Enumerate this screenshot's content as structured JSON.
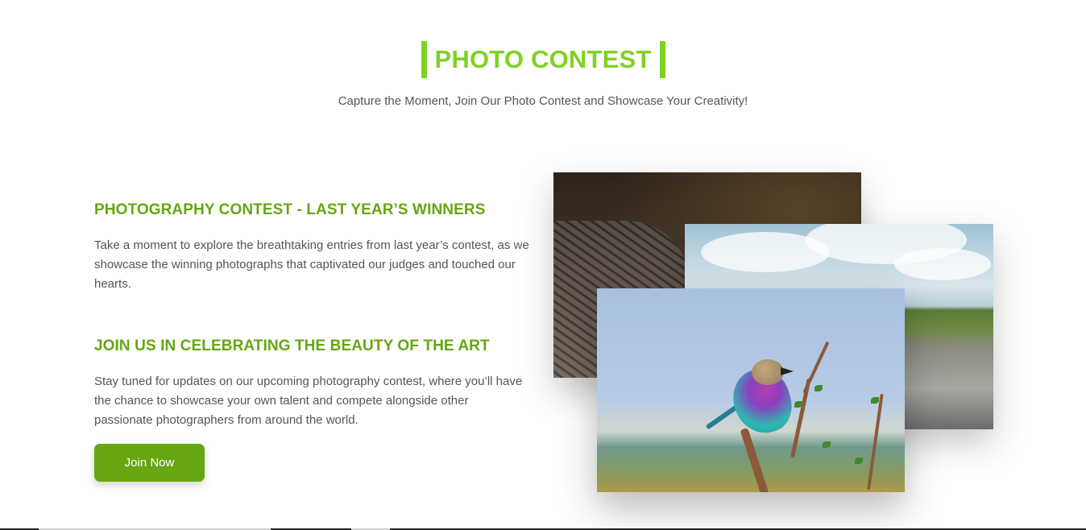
{
  "header": {
    "title": "PHOTO CONTEST",
    "subtitle": "Capture the Moment, Join Our Photo Contest and Showcase Your Creativity!"
  },
  "sections": [
    {
      "heading": "PHOTOGRAPHY CONTEST - LAST YEAR’S WINNERS",
      "text": "Take a moment to explore the breathtaking entries from last year’s contest, as we showcase the winning photographs that captivated our judges and touched our hearts."
    },
    {
      "heading": "JOIN US IN CELEBRATING THE BEAUTY OF THE ART",
      "text": "Stay tuned for updates on our upcoming photography contest, where you’ll have the chance to showcase your own talent and compete alongside other passionate photographers from around the world."
    }
  ],
  "cta": {
    "label": "Join Now"
  },
  "photos": [
    {
      "subject": "iguana-closeup"
    },
    {
      "subject": "coastal-cliff-landscape"
    },
    {
      "subject": "lilac-breasted-roller-bird"
    }
  ],
  "colors": {
    "accent": "#7ed321",
    "heading": "#66a613",
    "button": "#66a613",
    "text": "#555555"
  }
}
